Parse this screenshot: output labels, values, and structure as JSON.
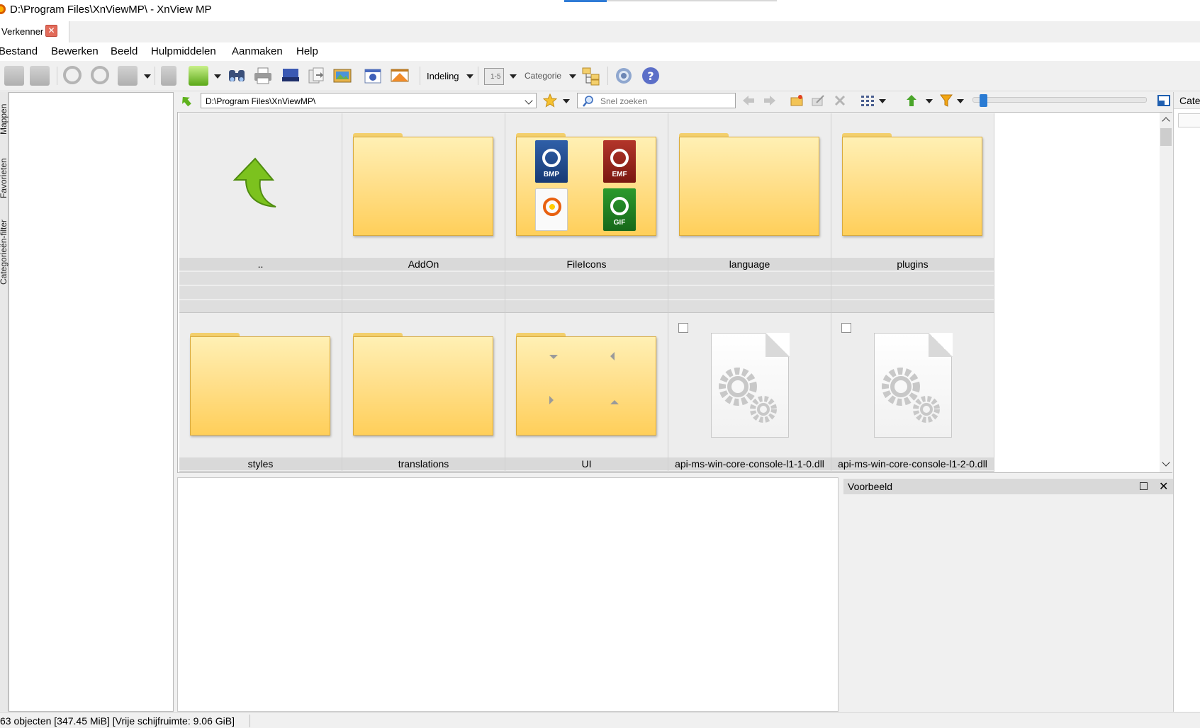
{
  "window": {
    "title": "D:\\Program Files\\XnViewMP\\ - XnView MP"
  },
  "tabs": [
    {
      "label": "Verkenner",
      "close_glyph": "✕"
    }
  ],
  "menu": [
    "Bestand",
    "Bewerken",
    "Beeld",
    "Hulpmiddelen",
    "Aanmaken",
    "Help"
  ],
  "toolbar": {
    "layout_label": "Indeling",
    "rating_label": "1-5",
    "category_label": "Categorie",
    "icons": [
      "fullscreen-icon",
      "slideshow-icon",
      "rotate-left-icon",
      "rotate-right-icon",
      "edit-image-icon",
      "properties-icon",
      "open-with-icon",
      "find-icon",
      "print-icon",
      "scan-icon",
      "batch-convert-icon",
      "wallpaper-icon",
      "capture-icon",
      "multipage-icon",
      "settings-gear-icon",
      "help-icon"
    ]
  },
  "sidebar": {
    "tabs": [
      "Mappen",
      "Favorieten",
      "Categorieën-filter"
    ]
  },
  "pathbar": {
    "path": "D:\\Program Files\\XnViewMP\\",
    "search_placeholder": "Snel zoeken"
  },
  "category_panel": {
    "title": "Categorie"
  },
  "files": [
    {
      "name": "..",
      "kind": "parent"
    },
    {
      "name": "AddOn",
      "kind": "folder"
    },
    {
      "name": "FileIcons",
      "kind": "folder-icons"
    },
    {
      "name": "language",
      "kind": "folder"
    },
    {
      "name": "plugins",
      "kind": "folder"
    },
    {
      "name": "styles",
      "kind": "folder"
    },
    {
      "name": "translations",
      "kind": "folder"
    },
    {
      "name": "UI",
      "kind": "folder-arrows"
    },
    {
      "name": "api-ms-win-core-console-l1-1-0.dll",
      "kind": "dll"
    },
    {
      "name": "api-ms-win-core-console-l1-2-0.dll",
      "kind": "dll"
    }
  ],
  "fileicon_badges": [
    "BMP",
    "EMF",
    "GIF"
  ],
  "preview": {
    "title": "Voorbeeld"
  },
  "status": {
    "text": "63 objecten [347.45 MiB] [Vrije schijfruimte: 9.06 GiB]"
  },
  "colors": {
    "accent": "#2a7bd3",
    "folder": "#ffdf85",
    "selection_bg": "#d9d9d9"
  }
}
